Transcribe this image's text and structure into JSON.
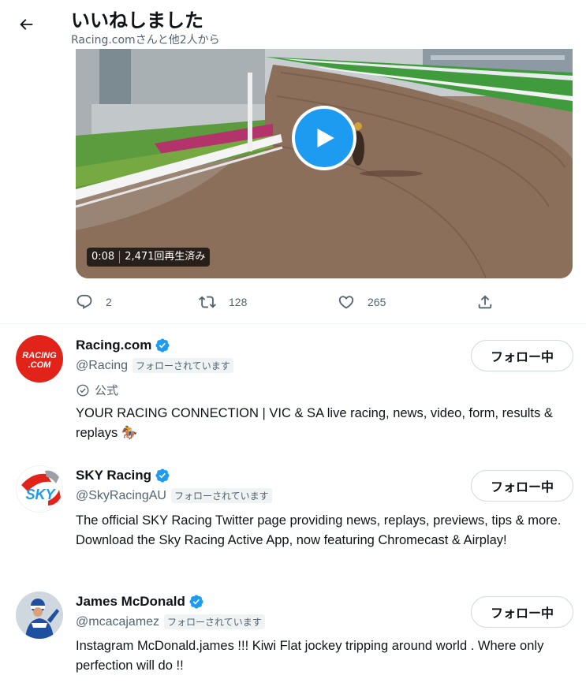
{
  "header": {
    "title": "いいねしました",
    "subtitle": "Racing.comさんと他2人から"
  },
  "video": {
    "timestamp": "0:08",
    "views": "2,471回再生済み"
  },
  "actions": {
    "replies": "2",
    "retweets": "128",
    "likes": "265"
  },
  "users": [
    {
      "name": "Racing.com",
      "handle": "@Racing",
      "follows_you": "フォローされています",
      "official_label": "公式",
      "bio": "YOUR RACING CONNECTION | VIC & SA live racing, news, video, form, results & replays 🏇",
      "follow_label": "フォロー中",
      "avatar_text": [
        "RACING",
        ".COM"
      ]
    },
    {
      "name": "SKY Racing",
      "handle": "@SkyRacingAU",
      "follows_you": "フォローされています",
      "bio": "The official SKY Racing Twitter page providing news, replays, previews, tips & more. Download the Sky Racing Active App, now featuring Chromecast & Airplay!",
      "follow_label": "フォロー中",
      "avatar_text": "SKY"
    },
    {
      "name": "James McDonald",
      "handle": "@mcacajamez",
      "follows_you": "フォローされています",
      "bio": "Instagram McDonald.james !!! Kiwi Flat jockey tripping around world . Where only perfection will do !!",
      "follow_label": "フォロー中"
    }
  ],
  "colors": {
    "accent": "#1d9bf0",
    "racing_red": "#e2231a",
    "text_secondary": "#536471"
  }
}
